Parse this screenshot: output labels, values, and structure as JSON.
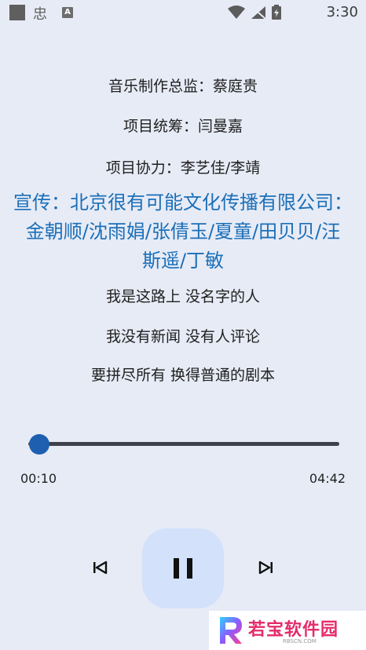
{
  "status_bar": {
    "time": "3:30",
    "app_glyph": "忠",
    "a_badge": "A"
  },
  "lyrics": [
    {
      "text": "音乐制作总监：蔡庭贵",
      "active": false
    },
    {
      "text": "项目统筹：闫曼嘉",
      "active": false
    },
    {
      "text": "项目协力：李艺佳/李靖",
      "active": false
    },
    {
      "lines": [
        "宣传：北京很有可能文化传播有限公司：",
        "金朝顺/沈雨娟/张倩玉/夏童/田贝贝/汪",
        "斯遥/丁敏"
      ],
      "active": true
    },
    {
      "text": "我是这路上 没名字的人",
      "active": false
    },
    {
      "text": "我没有新闻 没有人评论",
      "active": false
    },
    {
      "text": "要拼尽所有 换得普通的剧本",
      "active": false
    }
  ],
  "player": {
    "current_time": "00:10",
    "total_time": "04:42",
    "progress": 0.035
  },
  "icons": {
    "prev": "skip-previous-icon",
    "play_pause": "pause-icon",
    "next": "skip-next-icon"
  },
  "watermark": {
    "text": "若宝软件园",
    "sub": "RBSCN.COM",
    "accent": "#e52b6b"
  },
  "colors": {
    "background": "#e7ebf6",
    "active_lyric": "#1b6fb8",
    "thumb": "#1e5fb0",
    "play_button_bg": "#d3e1fb"
  }
}
